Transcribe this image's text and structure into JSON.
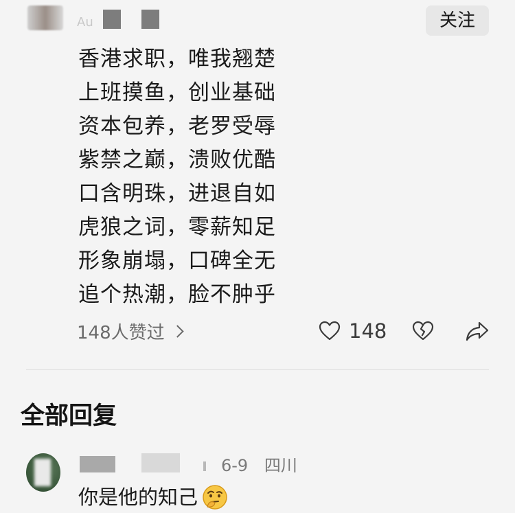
{
  "comment": {
    "follow_label": "关注",
    "name_hint": "Au",
    "poem_lines": [
      "香港求职，唯我翘楚",
      "上班摸鱼，创业基础",
      "资本包养，老罗受辱",
      "紫禁之巅，溃败优酷",
      "口含明珠，进退自如",
      "虎狼之词，零薪知足",
      "形象崩塌，口碑全无",
      "追个热潮，脸不肿乎"
    ],
    "likes_summary": "148人赞过",
    "like_count": "148",
    "icons": {
      "heart": "heart-outline-icon",
      "dislike": "broken-heart-icon",
      "share": "share-arrow-icon",
      "chevron": "chevron-right-icon",
      "emoji": "thinking-face-emoji"
    }
  },
  "replies_section": {
    "title": "全部回复",
    "reply": {
      "date": "6-9",
      "location": "四川",
      "text": "你是他的知己"
    }
  }
}
